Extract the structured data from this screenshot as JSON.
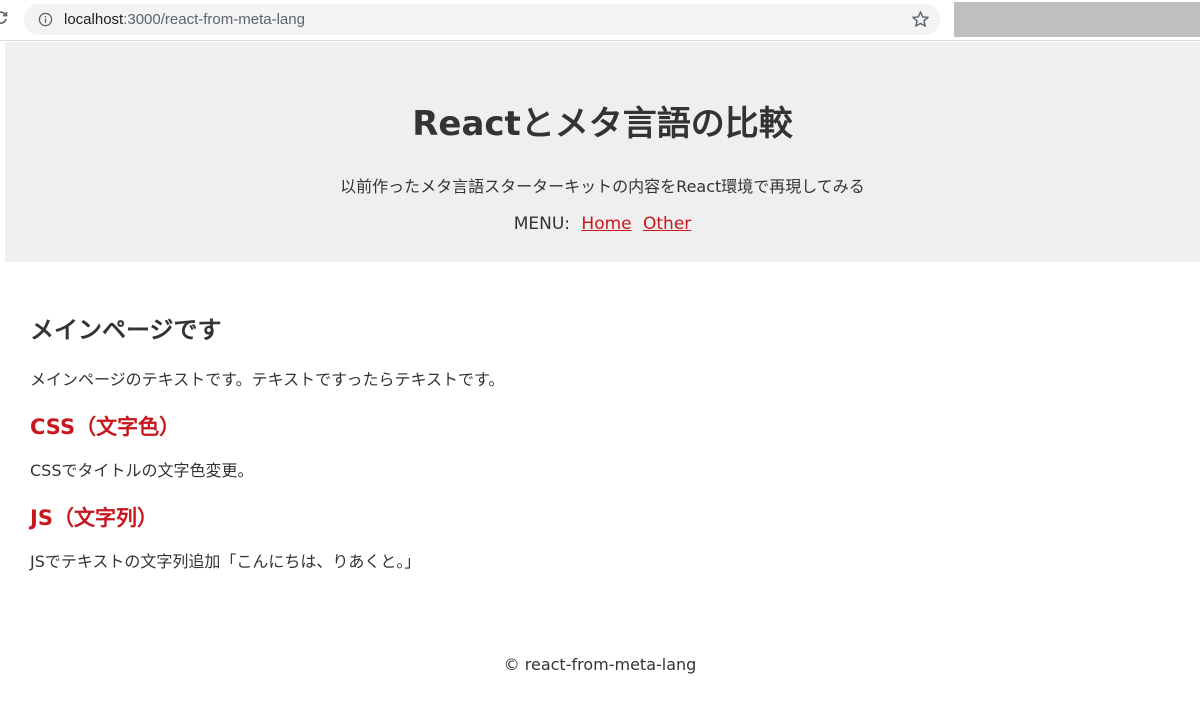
{
  "browser": {
    "url_host": "localhost",
    "url_path": ":3000/react-from-meta-lang"
  },
  "header": {
    "title": "Reactとメタ言語の比較",
    "description": "以前作ったメタ言語スターターキットの内容をReact環境で再現してみる",
    "menu_label": "MENU:",
    "menu_items": [
      {
        "label": "Home"
      },
      {
        "label": "Other"
      }
    ]
  },
  "main": {
    "heading": "メインページです",
    "intro": "メインページのテキストです。テキストですったらテキストです。",
    "sections": [
      {
        "title": "CSS（文字色）",
        "body": "CSSでタイトルの文字色変更。"
      },
      {
        "title": "JS（文字列）",
        "body": "JSでテキストの文字列追加「こんにちは、りあくと。」"
      }
    ]
  },
  "footer": {
    "text": "© react-from-meta-lang"
  },
  "colors": {
    "accent_red": "#c8161d",
    "header_bg": "#efefef",
    "text": "#333333"
  }
}
